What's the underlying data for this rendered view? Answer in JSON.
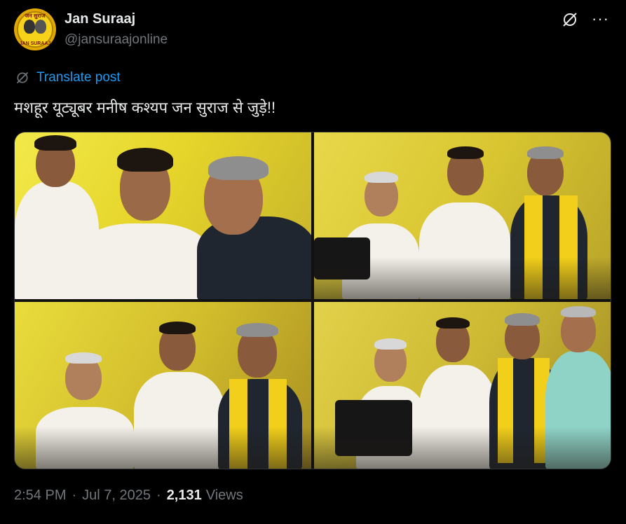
{
  "author": {
    "name": "Jan Suraaj",
    "handle": "@jansuraajonline",
    "avatar_text_top": "जन सुराज",
    "avatar_text_bottom": "JAN SURAAJ"
  },
  "actions": {
    "grok_icon": "grok-slash-circle-icon",
    "more_label": "···"
  },
  "translate": {
    "label": "Translate post",
    "icon": "translate-icon"
  },
  "post": {
    "text": "मशहूर यूट्यूबर मनीष कश्यप जन सुराज से जुड़े!!"
  },
  "media": {
    "photo_count": 4
  },
  "meta": {
    "time": "2:54 PM",
    "separator": "·",
    "date": "Jul 7, 2025",
    "views_count": "2,131",
    "views_label": "Views"
  },
  "colors": {
    "background": "#000000",
    "text": "#e7e9ea",
    "secondary": "#71767b",
    "accent": "#1d9bf0"
  }
}
